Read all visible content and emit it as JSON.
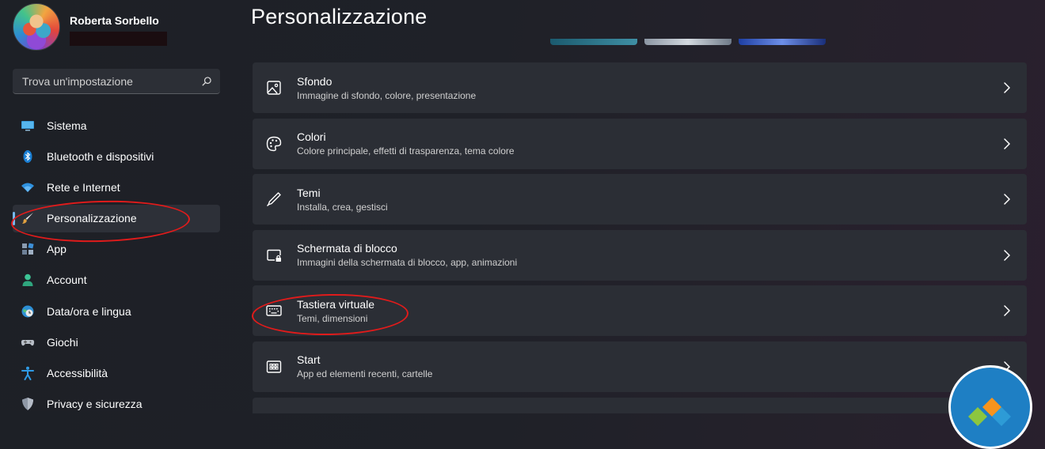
{
  "user": {
    "name": "Roberta Sorbello"
  },
  "search": {
    "placeholder": "Trova un'impostazione"
  },
  "sidebar": {
    "items": [
      {
        "label": "Sistema",
        "icon": "monitor-icon"
      },
      {
        "label": "Bluetooth e dispositivi",
        "icon": "bluetooth-icon"
      },
      {
        "label": "Rete e Internet",
        "icon": "wifi-icon"
      },
      {
        "label": "Personalizzazione",
        "icon": "brush-icon",
        "active": true
      },
      {
        "label": "App",
        "icon": "apps-icon"
      },
      {
        "label": "Account",
        "icon": "person-icon"
      },
      {
        "label": "Data/ora e lingua",
        "icon": "globe-clock-icon"
      },
      {
        "label": "Giochi",
        "icon": "gamepad-icon"
      },
      {
        "label": "Accessibilità",
        "icon": "accessibility-icon"
      },
      {
        "label": "Privacy e sicurezza",
        "icon": "shield-icon"
      }
    ]
  },
  "main": {
    "title": "Personalizzazione",
    "cards": [
      {
        "title": "Sfondo",
        "subtitle": "Immagine di sfondo, colore, presentazione",
        "icon": "image-icon"
      },
      {
        "title": "Colori",
        "subtitle": "Colore principale, effetti di trasparenza, tema colore",
        "icon": "palette-icon"
      },
      {
        "title": "Temi",
        "subtitle": "Installa, crea, gestisci",
        "icon": "pen-icon"
      },
      {
        "title": "Schermata di blocco",
        "subtitle": "Immagini della schermata di blocco, app, animazioni",
        "icon": "lock-screen-icon"
      },
      {
        "title": "Tastiera virtuale",
        "subtitle": "Temi, dimensioni",
        "icon": "keyboard-icon"
      },
      {
        "title": "Start",
        "subtitle": "App ed elementi recenti, cartelle",
        "icon": "start-icon"
      }
    ]
  },
  "colors": {
    "accent": "#76b9ed",
    "annotation": "#e01b1b",
    "card_bg": "#2b2e35"
  }
}
